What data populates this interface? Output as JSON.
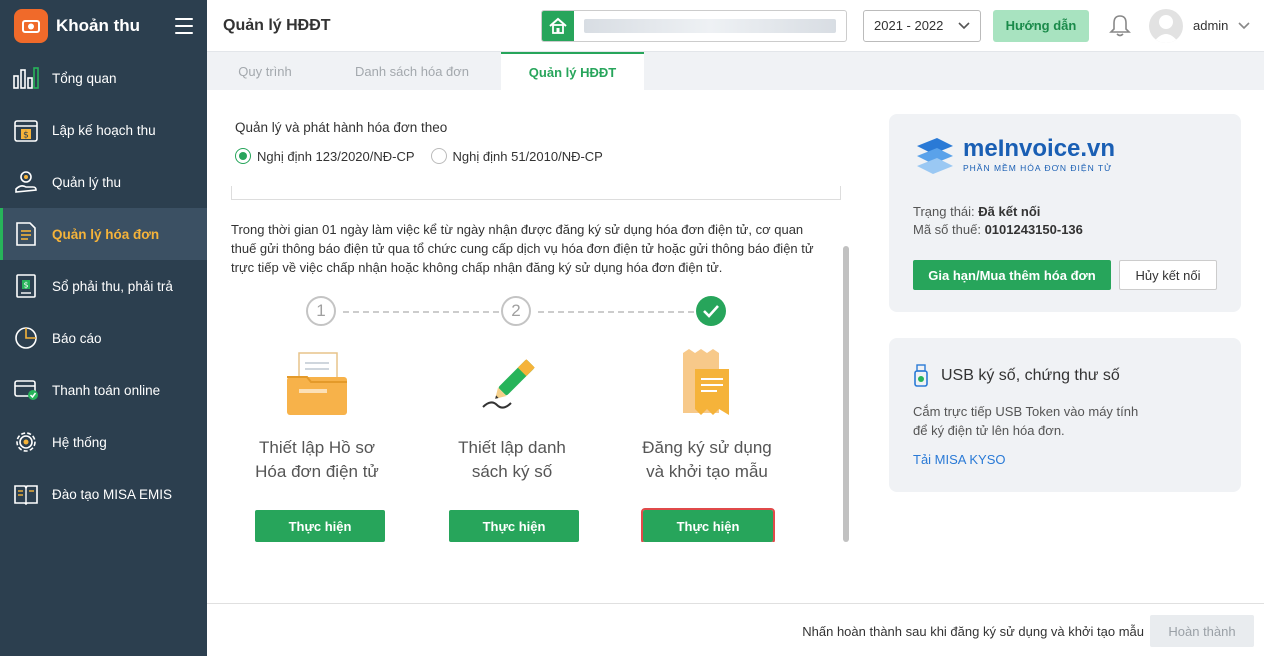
{
  "app": {
    "title": "Khoản thu"
  },
  "sidebar": {
    "items": [
      {
        "label": "Tổng quan",
        "icon": "bar-chart-icon"
      },
      {
        "label": "Lập kế hoạch thu",
        "icon": "calendar-dollar-icon"
      },
      {
        "label": "Quản lý thu",
        "icon": "hand-coin-icon"
      },
      {
        "label": "Quản lý hóa đơn",
        "icon": "document-icon",
        "active": true
      },
      {
        "label": "Sổ phải thu, phải trả",
        "icon": "ledger-icon"
      },
      {
        "label": "Báo cáo",
        "icon": "pie-chart-icon"
      },
      {
        "label": "Thanh toán online",
        "icon": "card-check-icon"
      },
      {
        "label": "Hệ thống",
        "icon": "gear-icon"
      },
      {
        "label": "Đào tạo MISA EMIS",
        "icon": "book-icon"
      }
    ]
  },
  "header": {
    "page_title": "Quản lý HĐĐT",
    "school_year": "2021 - 2022",
    "help_label": "Hướng dẫn",
    "username": "admin"
  },
  "tabs": [
    {
      "label": "Quy trình"
    },
    {
      "label": "Danh sách hóa đơn"
    },
    {
      "label": "Quản lý HĐĐT",
      "active": true
    }
  ],
  "registration": {
    "title": "Quản lý và phát hành hóa đơn theo",
    "options": [
      {
        "label": "Nghị định 123/2020/NĐ-CP",
        "selected": true
      },
      {
        "label": "Nghị định 51/2010/NĐ-CP",
        "selected": false
      }
    ],
    "description": "Trong thời gian 01 ngày làm việc kể từ ngày nhận được đăng ký sử dụng hóa đơn điện tử, cơ quan thuế gửi thông báo điện tử qua tổ chức cung cấp dịch vụ hóa đơn điện tử hoặc gửi thông báo điện tử trực tiếp về việc chấp nhận hoặc không chấp nhận đăng ký sử dụng hóa đơn điện tử."
  },
  "steps": [
    {
      "number": "1",
      "line1": "Thiết lập Hồ sơ",
      "line2": "Hóa đơn điện tử",
      "button": "Thực hiện",
      "done": false
    },
    {
      "number": "2",
      "line1": "Thiết lập danh",
      "line2": "sách ký số",
      "button": "Thực hiện",
      "done": false
    },
    {
      "number": "3",
      "line1": "Đăng ký sử dụng",
      "line2": "và khởi tạo mẫu",
      "button": "Thực hiện",
      "done": true
    }
  ],
  "meinvoice": {
    "brand": "meInvoice.vn",
    "tagline": "PHẦN MỀM HÓA ĐƠN ĐIỆN TỬ",
    "status_label": "Trạng thái:",
    "status_value": "Đã kết nối",
    "tax_label": "Mã số thuế:",
    "tax_value": "0101243150-136",
    "renew_button": "Gia hạn/Mua thêm hóa đơn",
    "disconnect_button": "Hủy kết nối"
  },
  "usb": {
    "title": "USB ký số, chứng thư số",
    "description": "Cắm trực tiếp USB Token vào máy tính để ký điện tử lên hóa đơn.",
    "link": "Tải MISA KYSO"
  },
  "footer": {
    "note": "Nhấn hoàn thành sau khi đăng ký sử dụng và khởi tạo mẫu",
    "done_button": "Hoàn thành"
  },
  "colors": {
    "primary": "#27a55b",
    "sidebar": "#2c3f4f",
    "accent": "#f5b33a",
    "brand": "#1a5fb4"
  }
}
